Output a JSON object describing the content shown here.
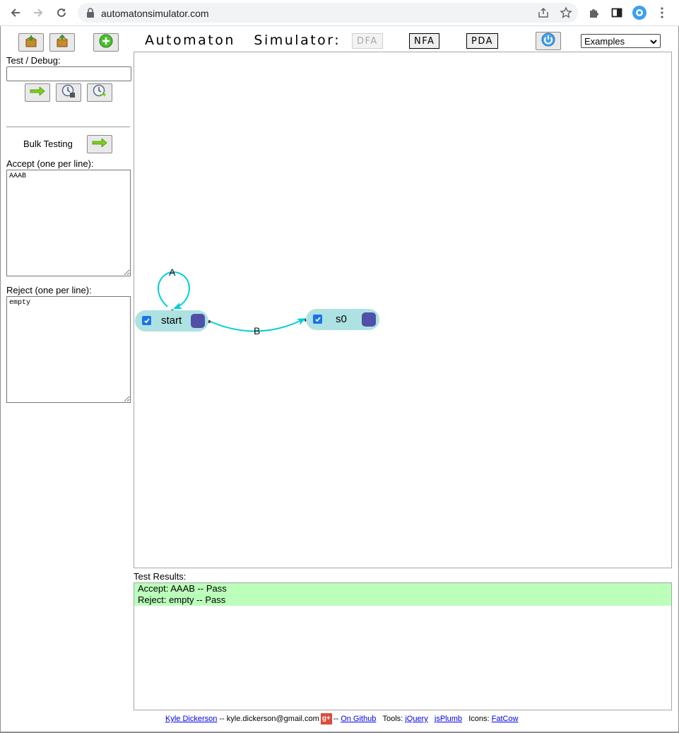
{
  "browser": {
    "url": "automatonsimulator.com"
  },
  "sidebar": {
    "test_debug_label": "Test / Debug:",
    "test_input_value": "",
    "bulk_testing_label": "Bulk Testing",
    "accept_label": "Accept (one per line):",
    "accept_value": "AAAB",
    "reject_label": "Reject (one per line):",
    "reject_value": "empty"
  },
  "header": {
    "title": "Automaton Simulator:",
    "modes": [
      "DFA",
      "NFA",
      "PDA"
    ],
    "active_mode": "DFA",
    "examples_label": "Examples"
  },
  "automaton": {
    "states": [
      {
        "name": "start",
        "accepting": true
      },
      {
        "name": "s0",
        "accepting": true
      }
    ],
    "transitions": [
      {
        "from": "start",
        "to": "start",
        "symbol": "A"
      },
      {
        "from": "start",
        "to": "s0",
        "symbol": "B"
      }
    ]
  },
  "results": {
    "label": "Test Results:",
    "rows": [
      "Accept: AAAB -- Pass",
      "Reject: empty -- Pass"
    ]
  },
  "footer": {
    "author_link": "Kyle Dickerson",
    "email_text": "-- kyle.dickerson@gmail.com",
    "gplus_text": "g+",
    "sep": "--",
    "github_link": "On Github",
    "tools_label": "Tools:",
    "jquery_link": "jQuery",
    "jsplumb_link": "jsPlumb",
    "icons_label": "Icons:",
    "fatcow_link": "FatCow"
  },
  "colors": {
    "state_fill": "#aee2e2",
    "state_handle": "#5050a8",
    "edge": "#00cfd6",
    "pass_row": "#bbffbb"
  }
}
